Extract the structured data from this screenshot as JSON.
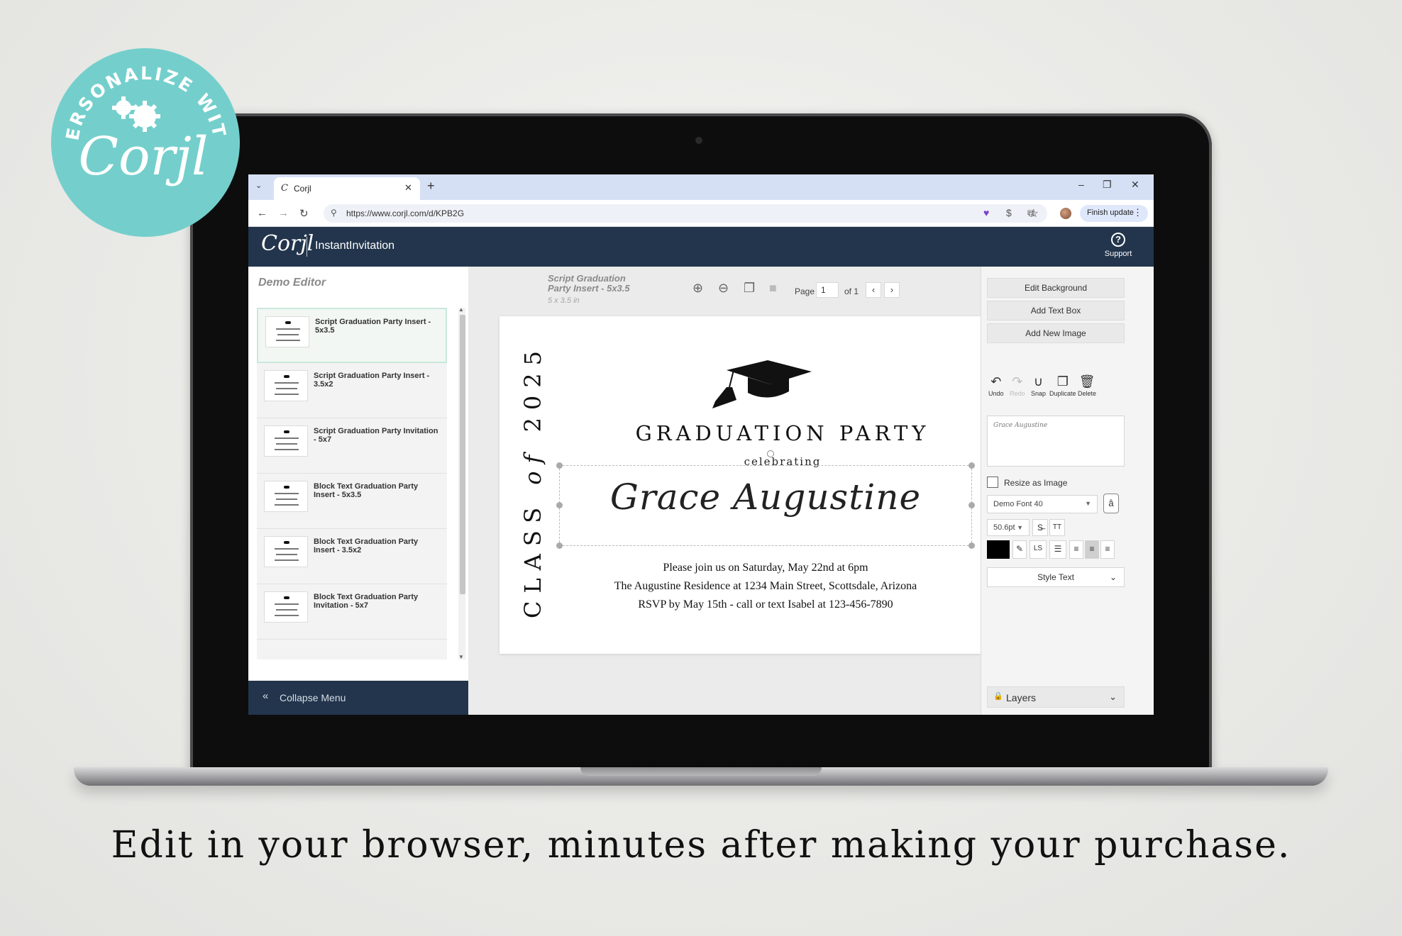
{
  "badge": {
    "arc_text": "PERSONALIZE WITH",
    "logo_text": "Corjl",
    "color": "#74cfcc"
  },
  "browser": {
    "tab_title": "Corjl",
    "url": "https://www.corjl.com/d/KPB2G",
    "finish_update": "Finish update"
  },
  "app": {
    "logo": "Corjl",
    "name": "InstantInvitation",
    "support_label": "Support",
    "header_color": "#22354c"
  },
  "left_panel": {
    "title": "Demo Editor",
    "templates": [
      {
        "label": "Script Graduation Party Insert - 5x3.5",
        "selected": true
      },
      {
        "label": "Script Graduation Party Insert - 3.5x2",
        "selected": false
      },
      {
        "label": "Script Graduation Party Invitation - 5x7",
        "selected": false
      },
      {
        "label": "Block Text Graduation Party Insert - 5x3.5",
        "selected": false
      },
      {
        "label": "Block Text Graduation Party Insert - 3.5x2",
        "selected": false
      },
      {
        "label": "Block Text Graduation Party Invitation - 5x7",
        "selected": false
      }
    ],
    "collapse_label": "Collapse Menu"
  },
  "canvas_toolbar": {
    "doc_title": "Script Graduation Party Insert - 5x3.5",
    "doc_size": "5 x 3.5 in",
    "page_label": "Page",
    "page_value": "1",
    "page_of": "of 1"
  },
  "card": {
    "vertical_prefix": "CLASS",
    "vertical_of": "of",
    "vertical_year": "2025",
    "title": "GRADUATION PARTY",
    "celebrating": "celebrating",
    "name": "Grace Augustine",
    "line1": "Please join us on Saturday, May 22nd at 6pm",
    "line2": "The Augustine Residence at 1234 Main Street, Scottsdale, Arizona",
    "line3": "RSVP by May 15th - call or text Isabel at 123-456-7890"
  },
  "right_panel": {
    "edit_background": "Edit Background",
    "add_text_box": "Add Text Box",
    "add_new_image": "Add New Image",
    "tools": {
      "undo": "Undo",
      "redo": "Redo",
      "snap": "Snap",
      "duplicate": "Duplicate",
      "delete": "Delete"
    },
    "preview_text": "Grace Augustine",
    "resize_label": "Resize as Image",
    "font_name": "Demo Font 40",
    "font_size": "50.6pt",
    "text_color": "#000000",
    "style_text": "Style Text",
    "layers_label": "Layers"
  },
  "caption": "Edit in your browser, minutes after making your purchase."
}
